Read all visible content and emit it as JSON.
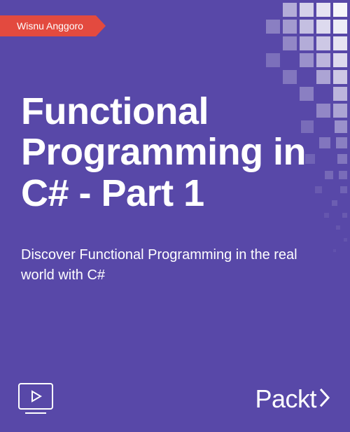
{
  "author": "Wisnu Anggoro",
  "title": "Functional Programming in C# - Part 1",
  "subtitle": "Discover Functional Programming in the real world with C#",
  "publisher": "Packt",
  "colors": {
    "background": "#5848a8",
    "ribbon": "#e34a3f",
    "text": "#ffffff"
  },
  "icons": {
    "video": "video-play-icon",
    "bracket": "angle-bracket-icon"
  }
}
